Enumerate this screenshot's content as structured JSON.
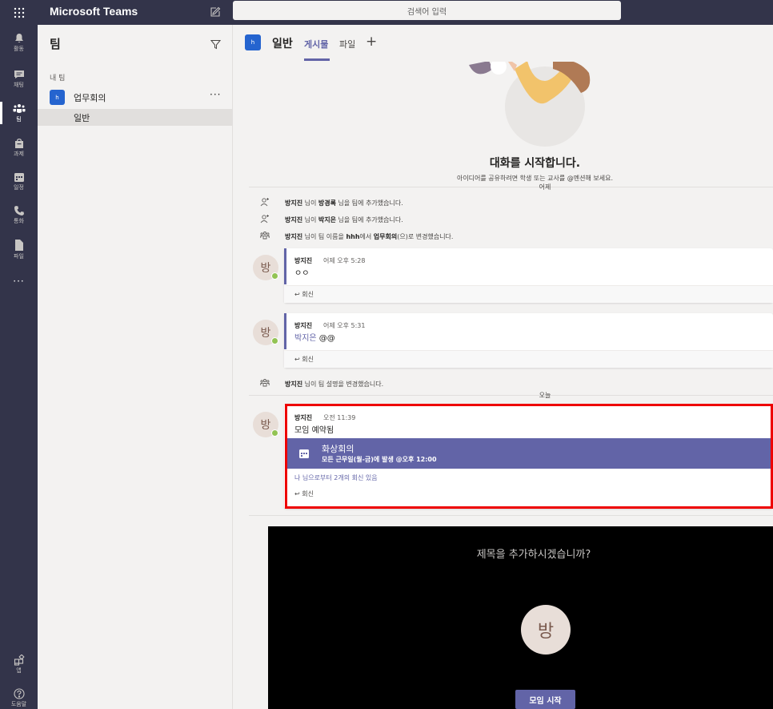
{
  "app": {
    "title": "Microsoft Teams"
  },
  "search": {
    "placeholder": "검색어 입력"
  },
  "rail": {
    "items": [
      {
        "label": "활동",
        "icon": "bell-icon"
      },
      {
        "label": "채팅",
        "icon": "chat-icon"
      },
      {
        "label": "팀",
        "icon": "teams-icon"
      },
      {
        "label": "과제",
        "icon": "assignments-icon"
      },
      {
        "label": "일정",
        "icon": "calendar-icon"
      },
      {
        "label": "통화",
        "icon": "phone-icon"
      },
      {
        "label": "파일",
        "icon": "file-icon"
      }
    ],
    "more": "···",
    "apps": {
      "label": "앱",
      "icon": "apps-icon"
    },
    "help": {
      "label": "도움말",
      "icon": "help-icon"
    }
  },
  "teams_panel": {
    "title": "팀",
    "my_teams": "내 팀",
    "team": {
      "avatar": "h",
      "name": "업무회의",
      "more": "···"
    },
    "channel": "일반"
  },
  "channel": {
    "avatar": "h",
    "title": "일반",
    "tabs": {
      "posts": "게시물",
      "files": "파일",
      "add": "+"
    }
  },
  "feed": {
    "start_title": "대화를 시작합니다.",
    "start_subtitle": "아이디어를 공유하려면 학생 또는 교사를 @멘션해 보세요.",
    "date_yesterday": "어제",
    "system_messages": [
      {
        "actor": "방지진",
        "t1": " 님이 ",
        "target": "방경록",
        "t2": " 님을 팀에 추가했습니다.",
        "icon": "add-member-icon"
      },
      {
        "actor": "방지진",
        "t1": " 님이 ",
        "target": "박지은",
        "t2": " 님을 팀에 추가했습니다.",
        "icon": "add-member-icon"
      },
      {
        "actor": "방지진",
        "t1": " 님이 팀 이름을 ",
        "target": "hhh",
        "t2": "에서 ",
        "target2": "업무회의",
        "t3": "(으)로 변경했습니다.",
        "icon": "team-icon"
      }
    ],
    "posts": [
      {
        "avatar": "방",
        "author": "방지진",
        "time": "어제 오후 5:28",
        "body": "ㅇㅇ",
        "reply": "회신"
      },
      {
        "avatar": "방",
        "author": "방지진",
        "time": "어제 오후 5:31",
        "mention": "박지은",
        "body": "@@",
        "reply": "회신"
      }
    ],
    "system_message_4": {
      "actor": "방지진",
      "text": " 님이 팀 설명을 변경했습니다.",
      "icon": "team-icon"
    },
    "date_today": "오늘",
    "meeting_post": {
      "avatar": "방",
      "author": "방지진",
      "time": "오전 11:39",
      "body": "모임 예약됨",
      "meeting_title": "화상회의",
      "meeting_schedule": "모든 근무일(월-금)에 발생 @오후 12:00",
      "replies_from": "나 님으로부터 2개의 회신 있음",
      "reply": "회신"
    },
    "meeting_preview": {
      "question": "제목을 추가하시겠습니까?",
      "avatar": "방",
      "start_button": "모임 시작"
    }
  },
  "colors": {
    "accent": "#6264a7",
    "rail": "#33344a",
    "highlight": "#ee0000"
  }
}
